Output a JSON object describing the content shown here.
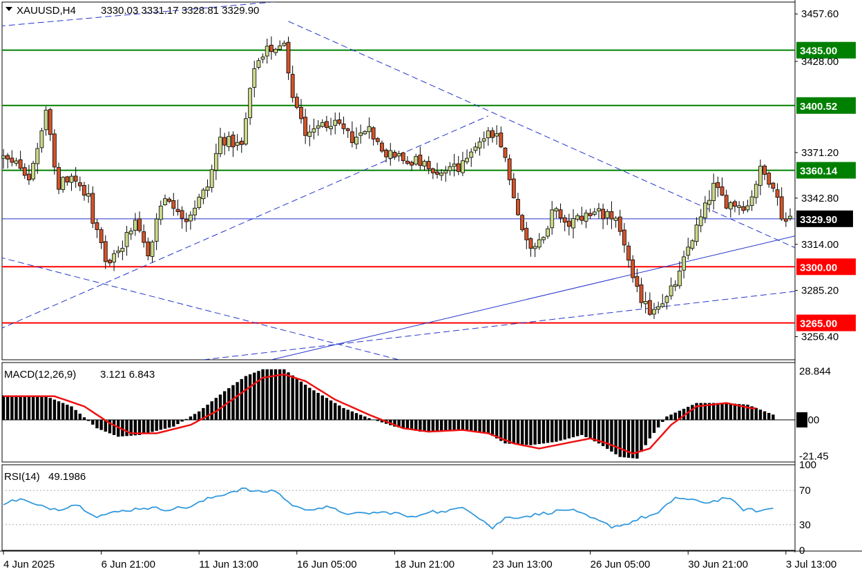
{
  "header": {
    "symbol": "XAUUSD,H4",
    "ohlc": "3330.03 3331.17 3328.81 3329.90"
  },
  "colors": {
    "bull": "#c8d88a",
    "bear": "#d2532a",
    "wick": "#000000",
    "support": "#ff0000",
    "resistance": "#008000",
    "trend": "#2233cc",
    "macd_hist": "#000000",
    "macd_signal": "#ee1111",
    "rsi_line": "#3399dd"
  },
  "chart_data": [
    {
      "type": "candlestick",
      "title": "XAUUSD,H4",
      "ylim": [
        3242,
        3465
      ],
      "y_ticks": [
        "3457.60",
        "3428.00",
        "3371.20",
        "3342.80",
        "3314.00",
        "3285.20",
        "3256.40"
      ],
      "x_ticks": [
        "4 Jun 2025",
        "6 Jun 21:00",
        "11 Jun 13:00",
        "16 Jun 05:00",
        "18 Jun 21:00",
        "23 Jun 13:00",
        "26 Jun 05:00",
        "30 Jun 21:00",
        "3 Jul 13:00"
      ],
      "x_tick_index": [
        0,
        23,
        46,
        69,
        92,
        115,
        138,
        161,
        184
      ],
      "candle_count": 186,
      "current_price": {
        "label": "3329.90",
        "value": 3329.9
      },
      "horizontal_levels": [
        {
          "label": "3435.00",
          "value": 3435.0,
          "kind": "resistance"
        },
        {
          "label": "3400.52",
          "value": 3400.52,
          "kind": "resistance"
        },
        {
          "label": "3360.14",
          "value": 3360.14,
          "kind": "resistance"
        },
        {
          "label": "3300.00",
          "value": 3300.0,
          "kind": "support"
        },
        {
          "label": "3265.00",
          "value": 3265.0,
          "kind": "support"
        }
      ],
      "trend_lines": [
        {
          "dashed": true,
          "from": [
            -1,
            3450
          ],
          "to": [
            170,
            3490
          ]
        },
        {
          "dashed": true,
          "from": [
            -1,
            3261
          ],
          "to": [
            114,
            3394
          ]
        },
        {
          "dashed": true,
          "from": [
            -1,
            3306
          ],
          "to": [
            93,
            3242
          ]
        },
        {
          "dashed": true,
          "from": [
            67,
            3453
          ],
          "to": [
            197,
            3299
          ]
        },
        {
          "dashed": true,
          "from": [
            47,
            3242
          ],
          "to": [
            197,
            3288
          ]
        },
        {
          "dashed": false,
          "from": [
            63,
            3242
          ],
          "to": [
            197,
            3326
          ]
        }
      ],
      "anchors": [
        [
          0,
          3368
        ],
        [
          6,
          3355
        ],
        [
          10,
          3395
        ],
        [
          13,
          3350
        ],
        [
          16,
          3358
        ],
        [
          20,
          3340
        ],
        [
          24,
          3302
        ],
        [
          28,
          3315
        ],
        [
          31,
          3328
        ],
        [
          34,
          3308
        ],
        [
          38,
          3345
        ],
        [
          43,
          3330
        ],
        [
          48,
          3350
        ],
        [
          51,
          3380
        ],
        [
          56,
          3375
        ],
        [
          59,
          3425
        ],
        [
          62,
          3435
        ],
        [
          66,
          3440
        ],
        [
          68,
          3405
        ],
        [
          71,
          3385
        ],
        [
          77,
          3390
        ],
        [
          82,
          3380
        ],
        [
          86,
          3385
        ],
        [
          90,
          3370
        ],
        [
          94,
          3368
        ],
        [
          98,
          3365
        ],
        [
          102,
          3355
        ],
        [
          107,
          3362
        ],
        [
          110,
          3375
        ],
        [
          113,
          3380
        ],
        [
          116,
          3385
        ],
        [
          119,
          3355
        ],
        [
          121,
          3330
        ],
        [
          124,
          3312
        ],
        [
          127,
          3315
        ],
        [
          129,
          3335
        ],
        [
          132,
          3325
        ],
        [
          135,
          3330
        ],
        [
          140,
          3335
        ],
        [
          143,
          3330
        ],
        [
          146,
          3315
        ],
        [
          148,
          3290
        ],
        [
          150,
          3280
        ],
        [
          152,
          3272
        ],
        [
          154,
          3278
        ],
        [
          156,
          3280
        ],
        [
          159,
          3295
        ],
        [
          161,
          3312
        ],
        [
          164,
          3330
        ],
        [
          167,
          3350
        ],
        [
          170,
          3340
        ],
        [
          175,
          3338
        ],
        [
          178,
          3360
        ],
        [
          181,
          3352
        ],
        [
          183,
          3332
        ],
        [
          185,
          3329.9
        ]
      ]
    },
    {
      "type": "bar",
      "title": "MACD(12,26,9)",
      "values_text": "3.121 6.843",
      "ylim": [
        -25,
        34
      ],
      "y_ticks": [
        "28.844",
        "0.00",
        "-21.45"
      ],
      "series": [
        {
          "name": "main",
          "anchors": [
            [
              0,
              14.5
            ],
            [
              10,
              14
            ],
            [
              16,
              8
            ],
            [
              22,
              -5
            ],
            [
              27,
              -10
            ],
            [
              32,
              -9
            ],
            [
              40,
              -4
            ],
            [
              46,
              5
            ],
            [
              52,
              17
            ],
            [
              57,
              26
            ],
            [
              61,
              30
            ],
            [
              66,
              30
            ],
            [
              72,
              19
            ],
            [
              80,
              7
            ],
            [
              86,
              1
            ],
            [
              92,
              -4
            ],
            [
              98,
              -7
            ],
            [
              106,
              -6
            ],
            [
              114,
              -8
            ],
            [
              118,
              -14
            ],
            [
              124,
              -15
            ],
            [
              130,
              -13
            ],
            [
              136,
              -9
            ],
            [
              140,
              -14
            ],
            [
              145,
              -22
            ],
            [
              149,
              -23
            ],
            [
              152,
              -11
            ],
            [
              156,
              2
            ],
            [
              163,
              10
            ],
            [
              170,
              10
            ],
            [
              175,
              9
            ],
            [
              181,
              3.121
            ]
          ]
        },
        {
          "name": "signal",
          "anchors": [
            [
              0,
              14
            ],
            [
              12,
              14
            ],
            [
              19,
              8
            ],
            [
              25,
              -2
            ],
            [
              30,
              -8
            ],
            [
              36,
              -8
            ],
            [
              44,
              -3
            ],
            [
              50,
              5
            ],
            [
              56,
              16
            ],
            [
              61,
              25
            ],
            [
              66,
              27
            ],
            [
              71,
              23
            ],
            [
              78,
              12
            ],
            [
              86,
              3
            ],
            [
              94,
              -5
            ],
            [
              100,
              -7
            ],
            [
              108,
              -6
            ],
            [
              114,
              -8
            ],
            [
              120,
              -14
            ],
            [
              126,
              -17
            ],
            [
              132,
              -14
            ],
            [
              138,
              -11
            ],
            [
              142,
              -14
            ],
            [
              148,
              -20
            ],
            [
              152,
              -17
            ],
            [
              157,
              -3
            ],
            [
              163,
              8
            ],
            [
              170,
              10
            ],
            [
              176,
              6.843
            ]
          ]
        }
      ]
    },
    {
      "type": "line",
      "title": "RSI(14)",
      "value_text": "49.1986",
      "ylim": [
        0,
        100
      ],
      "y_ticks": [
        "100",
        "70",
        "30",
        "0"
      ],
      "levels": [
        70,
        30
      ],
      "series": [
        {
          "name": "RSI",
          "anchors": [
            [
              0,
              55
            ],
            [
              4,
              60
            ],
            [
              8,
              52
            ],
            [
              13,
              48
            ],
            [
              17,
              54
            ],
            [
              22,
              40
            ],
            [
              28,
              46
            ],
            [
              33,
              50
            ],
            [
              38,
              48
            ],
            [
              44,
              51
            ],
            [
              48,
              60
            ],
            [
              52,
              66
            ],
            [
              56,
              72
            ],
            [
              60,
              68
            ],
            [
              64,
              70
            ],
            [
              67,
              56
            ],
            [
              70,
              48
            ],
            [
              76,
              50
            ],
            [
              82,
              42
            ],
            [
              87,
              44
            ],
            [
              92,
              44
            ],
            [
              96,
              38
            ],
            [
              100,
              46
            ],
            [
              104,
              44
            ],
            [
              108,
              52
            ],
            [
              112,
              38
            ],
            [
              115,
              26
            ],
            [
              118,
              38
            ],
            [
              123,
              40
            ],
            [
              128,
              44
            ],
            [
              133,
              48
            ],
            [
              138,
              38
            ],
            [
              143,
              28
            ],
            [
              146,
              30
            ],
            [
              150,
              38
            ],
            [
              154,
              43
            ],
            [
              158,
              62
            ],
            [
              162,
              58
            ],
            [
              166,
              56
            ],
            [
              170,
              62
            ],
            [
              174,
              48
            ],
            [
              178,
              46
            ],
            [
              181,
              49.1986
            ]
          ]
        }
      ]
    }
  ]
}
